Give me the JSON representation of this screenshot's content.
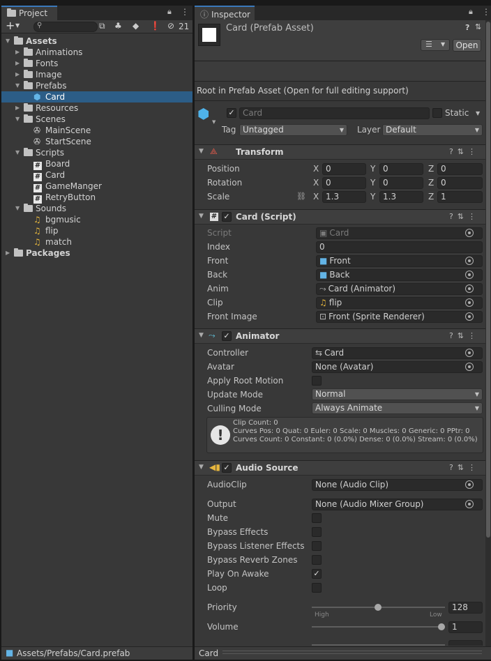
{
  "project": {
    "tab_label": "Project",
    "search_placeholder": "",
    "hidden_count": "21",
    "footer_path": "Assets/Prefabs/Card.prefab",
    "tree": [
      {
        "label": "Assets",
        "icon": "folder-open",
        "bold": true,
        "level": 0,
        "expanded": true
      },
      {
        "label": "Animations",
        "icon": "folder",
        "level": 1
      },
      {
        "label": "Fonts",
        "icon": "folder",
        "level": 1
      },
      {
        "label": "Image",
        "icon": "folder",
        "level": 1
      },
      {
        "label": "Prefabs",
        "icon": "folder-open",
        "level": 1,
        "expanded": true
      },
      {
        "label": "Card",
        "icon": "cube",
        "level": 2,
        "selected": true
      },
      {
        "label": "Resources",
        "icon": "folder",
        "level": 1
      },
      {
        "label": "Scenes",
        "icon": "folder-open",
        "level": 1,
        "expanded": true
      },
      {
        "label": "MainScene",
        "icon": "unity",
        "level": 2
      },
      {
        "label": "StartScene",
        "icon": "unity",
        "level": 2
      },
      {
        "label": "Scripts",
        "icon": "folder-open",
        "level": 1,
        "expanded": true
      },
      {
        "label": "Board",
        "icon": "hash",
        "level": 2
      },
      {
        "label": "Card",
        "icon": "hash",
        "level": 2
      },
      {
        "label": "GameManger",
        "icon": "hash",
        "level": 2
      },
      {
        "label": "RetryButton",
        "icon": "hash",
        "level": 2
      },
      {
        "label": "Sounds",
        "icon": "folder-open",
        "level": 1,
        "expanded": true
      },
      {
        "label": "bgmusic",
        "icon": "note",
        "level": 2
      },
      {
        "label": "flip",
        "icon": "note",
        "level": 2
      },
      {
        "label": "match",
        "icon": "note",
        "level": 2
      },
      {
        "label": "Packages",
        "icon": "folder",
        "bold": true,
        "level": 0
      }
    ]
  },
  "inspector": {
    "tab_label": "Inspector",
    "asset_title": "Card (Prefab Asset)",
    "open_button": "Open",
    "root_notice": "Root in Prefab Asset (Open for full editing support)",
    "object_name": "Card",
    "static_label": "Static",
    "tag_label": "Tag",
    "tag_value": "Untagged",
    "layer_label": "Layer",
    "layer_value": "Default",
    "footer_label": "Card",
    "transform": {
      "title": "Transform",
      "rows": [
        {
          "label": "Position",
          "x": "0",
          "y": "0",
          "z": "0"
        },
        {
          "label": "Rotation",
          "x": "0",
          "y": "0",
          "z": "0"
        },
        {
          "label": "Scale",
          "x": "1.3",
          "y": "1.3",
          "z": "1"
        }
      ],
      "axis_x": "X",
      "axis_y": "Y",
      "axis_z": "Z"
    },
    "card_script": {
      "title": "Card (Script)",
      "script_label": "Script",
      "script_value": "Card",
      "index_label": "Index",
      "index_value": "0",
      "front_label": "Front",
      "front_value": "Front",
      "back_label": "Back",
      "back_value": "Back",
      "anim_label": "Anim",
      "anim_value": "Card (Animator)",
      "clip_label": "Clip",
      "clip_value": "flip",
      "front_image_label": "Front Image",
      "front_image_value": "Front (Sprite Renderer)"
    },
    "animator": {
      "title": "Animator",
      "controller_label": "Controller",
      "controller_value": "Card",
      "avatar_label": "Avatar",
      "avatar_value": "None (Avatar)",
      "apply_root_label": "Apply Root Motion",
      "update_mode_label": "Update Mode",
      "update_mode_value": "Normal",
      "culling_mode_label": "Culling Mode",
      "culling_mode_value": "Always Animate",
      "info_line1": "Clip Count: 0",
      "info_line2": "Curves Pos: 0 Quat: 0 Euler: 0 Scale: 0 Muscles: 0 Generic: 0 PPtr: 0",
      "info_line3": "Curves Count: 0 Constant: 0 (0.0%) Dense: 0 (0.0%) Stream: 0 (0.0%)"
    },
    "audio": {
      "title": "Audio Source",
      "clip_label": "AudioClip",
      "clip_value": "None (Audio Clip)",
      "output_label": "Output",
      "output_value": "None (Audio Mixer Group)",
      "mute_label": "Mute",
      "bypass_effects_label": "Bypass Effects",
      "bypass_listener_label": "Bypass Listener Effects",
      "bypass_reverb_label": "Bypass Reverb Zones",
      "play_on_awake_label": "Play On Awake",
      "loop_label": "Loop",
      "priority_label": "Priority",
      "priority_value": "128",
      "priority_high": "High",
      "priority_low": "Low",
      "volume_label": "Volume",
      "volume_value": "1"
    }
  }
}
